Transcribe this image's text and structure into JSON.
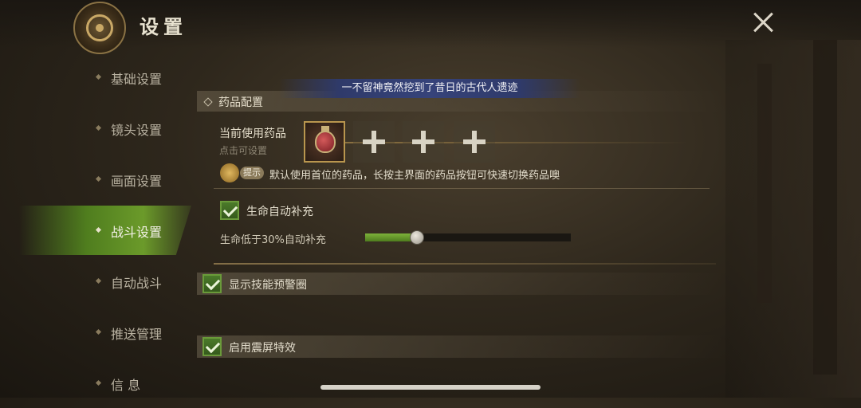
{
  "header": {
    "title": "设置"
  },
  "sidebar": {
    "items": [
      {
        "label": "基础设置"
      },
      {
        "label": "镜头设置"
      },
      {
        "label": "画面设置"
      },
      {
        "label": "战斗设置"
      },
      {
        "label": "自动战斗"
      },
      {
        "label": "推送管理"
      },
      {
        "label": "信 息"
      }
    ],
    "active": "战斗设置"
  },
  "banner": {
    "text": "一不留神竟然挖到了昔日的古代人遗迹"
  },
  "medicine": {
    "section_label": "药品配置",
    "current_label": "当前使用药品",
    "sub_label": "点击可设置",
    "slots": [
      {
        "state": "filled",
        "icon": "potion-icon"
      },
      {
        "state": "empty",
        "icon": "plus-icon"
      },
      {
        "state": "empty",
        "icon": "plus-icon"
      },
      {
        "state": "empty",
        "icon": "plus-icon"
      }
    ],
    "tip_badge": "提示",
    "tip_text": "默认使用首位的药品，长按主界面的药品按钮可快速切换药品噢"
  },
  "auto_heal": {
    "checkbox_label": "生命自动补充",
    "checked": true,
    "slider_label": "生命低于30%自动补充",
    "slider_value": 0.25
  },
  "options": [
    {
      "label": "显示技能预警圈",
      "checked": true
    },
    {
      "label": "启用震屏特效",
      "checked": true
    }
  ],
  "colors": {
    "accent": "#4f7d1e",
    "banner": "#36437a",
    "frame": "#b9964e"
  }
}
